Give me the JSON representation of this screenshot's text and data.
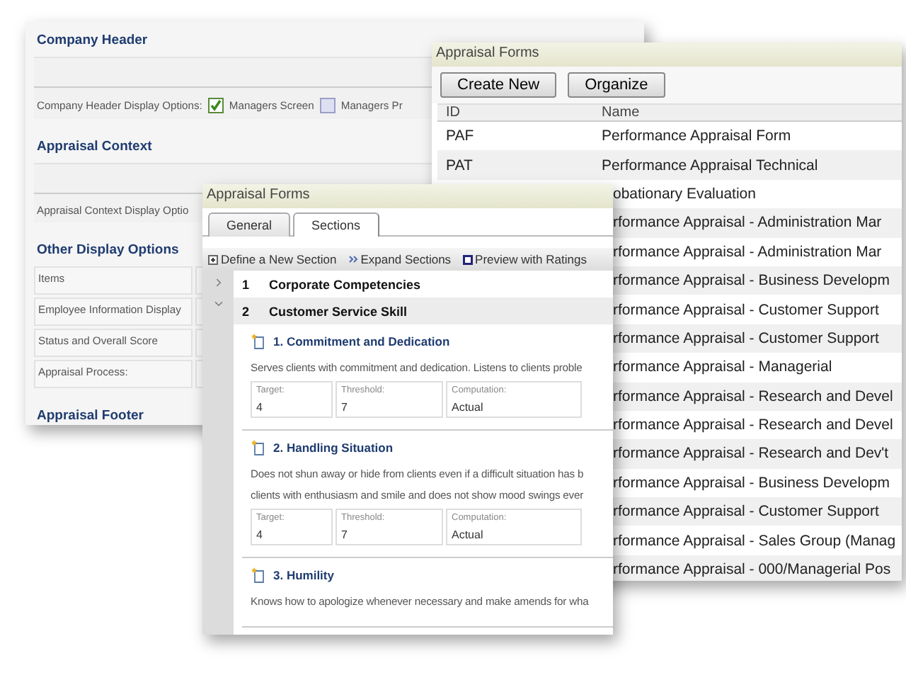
{
  "settings_window": {
    "sections": [
      {
        "kind": "options",
        "heading": "Company Header",
        "label": "Company Header Display Options:",
        "options": [
          {
            "label": "Managers Screen",
            "checked": true
          },
          {
            "label": "Managers Pr",
            "checked": false
          }
        ]
      },
      {
        "kind": "options",
        "heading": "Appraisal Context",
        "label": "Appraisal Context Display Optio"
      },
      {
        "kind": "table",
        "heading": "Other Display Options",
        "rows": [
          "Items",
          "Employee Information Display",
          "Status and Overall Score",
          "Appraisal Process:"
        ]
      },
      {
        "kind": "empty",
        "heading": "Appraisal Footer"
      }
    ]
  },
  "forms_list_window": {
    "title": "Appraisal Forms",
    "buttons": [
      "Create New",
      "Organize"
    ],
    "columns": [
      "ID",
      "Name"
    ],
    "rows": [
      {
        "kind": "full",
        "id": "PAF",
        "name": "Performance Appraisal Form"
      },
      {
        "kind": "full",
        "id": "PAT",
        "name": "Performance Appraisal Technical"
      },
      {
        "kind": "covered",
        "name": "obationary Evaluation"
      },
      {
        "kind": "covered",
        "name": "rformance Appraisal - Administration Mar"
      },
      {
        "kind": "covered",
        "name": "rformance Appraisal - Administration Mar"
      },
      {
        "kind": "covered",
        "name": "rformance Appraisal - Business Developm"
      },
      {
        "kind": "covered",
        "name": "rformance Appraisal - Customer Support"
      },
      {
        "kind": "covered",
        "name": "rformance Appraisal - Customer Support"
      },
      {
        "kind": "covered",
        "name": "rformance Appraisal - Managerial"
      },
      {
        "kind": "covered",
        "name": "rformance Appraisal - Research and Devel"
      },
      {
        "kind": "covered",
        "name": "rformance Appraisal - Research and Devel"
      },
      {
        "kind": "covered",
        "name": "rformance Appraisal - Research and Dev't"
      },
      {
        "kind": "covered",
        "name": "rformance Appraisal - Business Developm"
      },
      {
        "kind": "covered",
        "name": "rformance Appraisal - Customer Support"
      },
      {
        "kind": "covered",
        "name": "rformance Appraisal - Sales Group (Manag"
      },
      {
        "kind": "covered",
        "name": "rformance Appraisal - 000/Managerial Pos"
      }
    ]
  },
  "form_editor_window": {
    "title": "Appraisal Forms",
    "tabs": [
      {
        "label": "General",
        "selected": false
      },
      {
        "label": "Sections",
        "selected": true
      }
    ],
    "toolbar": [
      "Define a New Section",
      "Expand Sections",
      "Preview with Ratings"
    ],
    "sections": [
      {
        "number": "1",
        "name": "Corporate Competencies",
        "expanded": false
      },
      {
        "number": "2",
        "name": "Customer Service Skill",
        "expanded": true,
        "items": [
          {
            "title": "1. Commitment and Dedication",
            "description": [
              "Serves clients with commitment and dedication. Listens to clients proble"
            ],
            "metrics": [
              {
                "label": "Target:",
                "value": "4"
              },
              {
                "label": "Threshold:",
                "value": "7"
              },
              {
                "label": "Computation:",
                "value": "Actual"
              }
            ]
          },
          {
            "title": "2. Handling Situation",
            "description": [
              "Does not shun away or hide from clients even if a difficult situation has b",
              "clients with enthusiasm and smile and does not show mood swings ever"
            ],
            "metrics": [
              {
                "label": "Target:",
                "value": "4"
              },
              {
                "label": "Threshold:",
                "value": "7"
              },
              {
                "label": "Computation:",
                "value": "Actual"
              }
            ]
          },
          {
            "title": "3. Humility",
            "description": [
              "Knows how to apologize whenever necessary and make amends for wha"
            ]
          }
        ]
      }
    ]
  }
}
